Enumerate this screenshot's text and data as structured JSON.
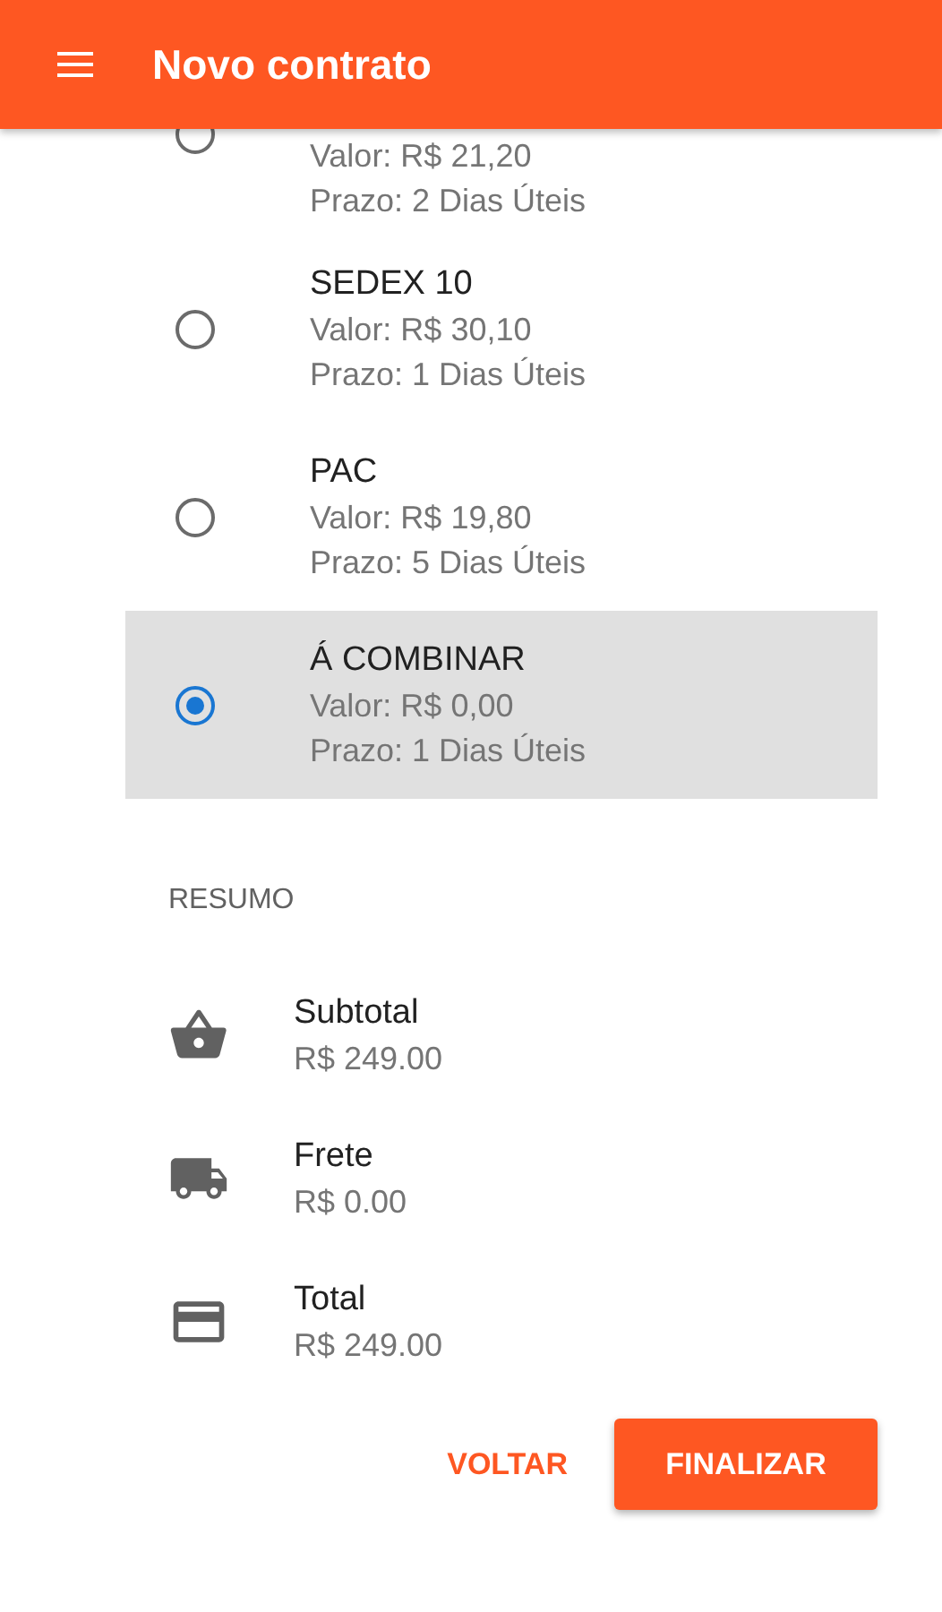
{
  "app_bar": {
    "title": "Novo contrato"
  },
  "shipping_options": [
    {
      "value": "Valor: R$ 21,20",
      "term": "Prazo: 2 Dias Úteis",
      "selected": false
    },
    {
      "name": "SEDEX 10",
      "value": "Valor: R$ 30,10",
      "term": "Prazo: 1 Dias Úteis",
      "selected": false
    },
    {
      "name": "PAC",
      "value": "Valor: R$ 19,80",
      "term": "Prazo: 5 Dias Úteis",
      "selected": false
    },
    {
      "name": "Á COMBINAR",
      "value": "Valor: R$ 0,00",
      "term": "Prazo: 1 Dias Úteis",
      "selected": true
    }
  ],
  "summary": {
    "heading": "RESUMO",
    "items": [
      {
        "kind": "basket",
        "label": "Subtotal",
        "value": "R$ 249.00"
      },
      {
        "kind": "truck",
        "label": "Frete",
        "value": "R$ 0.00"
      },
      {
        "kind": "card",
        "label": "Total",
        "value": "R$ 249.00"
      }
    ]
  },
  "actions": {
    "back": "VOLTAR",
    "finish": "FINALIZAR"
  }
}
